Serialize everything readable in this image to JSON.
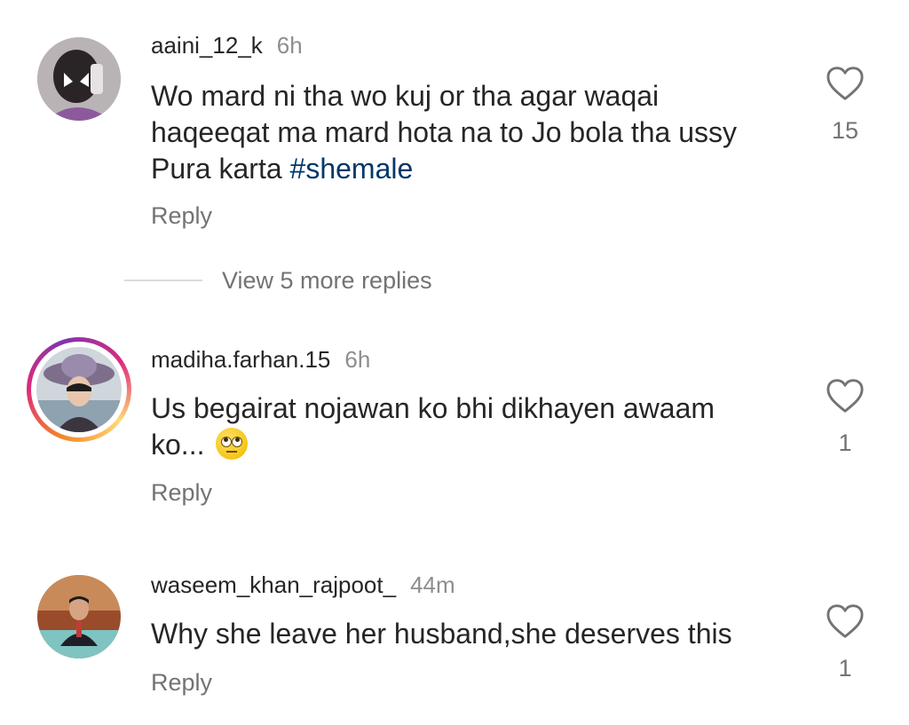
{
  "comments": [
    {
      "username": "aaini_12_k",
      "time": "6h",
      "text_plain": "Wo mard ni tha wo kuj or tha agar waqai haqeeqat ma mard hota na to Jo bola tha ussy Pura karta",
      "hashtag": "#shemale",
      "reply_label": "Reply",
      "likes": "15"
    },
    {
      "username": "madiha.farhan.15",
      "time": "6h",
      "text_plain": "Us begairat nojawan ko bhi dikhayen awaam ko...",
      "reply_label": "Reply",
      "likes": "1"
    },
    {
      "username": "waseem_khan_rajpoot_",
      "time": "44m",
      "text_plain": "Why she leave her husband,she deserves this",
      "reply_label": "Reply",
      "likes": "1"
    }
  ],
  "view_more_replies": "View 5 more replies",
  "icons": {
    "like": "heart-outline-icon",
    "emoji": "face-with-rolling-eyes"
  },
  "colors": {
    "hashtag": "#00376b",
    "secondary_text": "#737373",
    "story_ring": "#dd2a7b"
  }
}
